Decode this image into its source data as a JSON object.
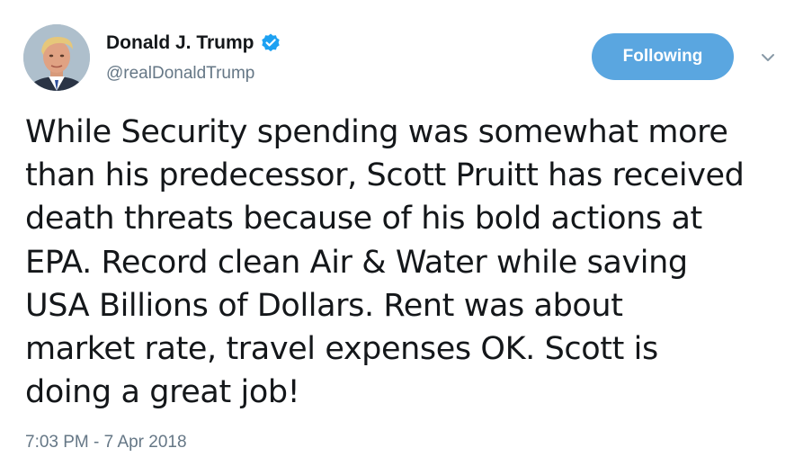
{
  "author": {
    "display_name": "Donald J. Trump",
    "handle": "@realDonaldTrump",
    "verified": true,
    "verified_color": "#1da1f2"
  },
  "actions": {
    "follow_label": "Following",
    "follow_color": "#5aa6e0",
    "menu_icon": "chevron-down-icon"
  },
  "tweet": {
    "lines": [
      "While Security spending was somewhat more",
      "than his predecessor, Scott Pruitt has received",
      "death threats because of his bold actions at",
      "EPA. Record clean Air & Water while saving",
      "USA Billions of Dollars. Rent was about",
      "market rate, travel expenses OK. Scott is",
      "doing a great job!"
    ],
    "timestamp": "7:03 PM - 7 Apr 2018"
  }
}
